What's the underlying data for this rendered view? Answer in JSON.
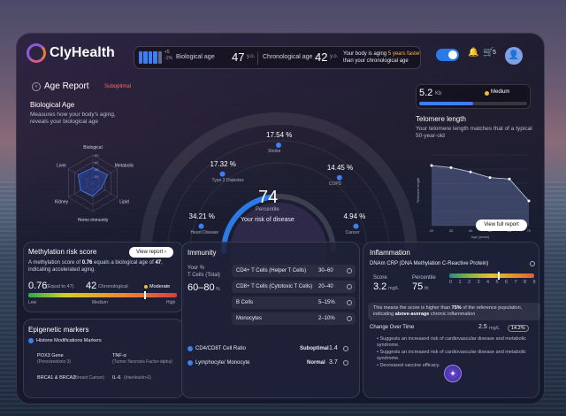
{
  "app": {
    "name": "ClyHealth"
  },
  "status": {
    "battery_delta": "+5",
    "battery_delta2": "-1%",
    "bio_label": "Biological age",
    "bio_val": "47",
    "bio_unit": "y.o.",
    "chrono_label": "Chronological age",
    "chrono_val": "42",
    "chrono_unit": "y.o.",
    "note_a": "Your body is aging ",
    "note_hl": "5 years faster",
    "note_b": " than your chronological age",
    "cart_count": "5"
  },
  "page": {
    "back": "‹",
    "title": "Age Report",
    "tag": "Suboptimal"
  },
  "bio": {
    "title": "Biological Age",
    "desc": "Measures how your body's aging, reveals your biological age",
    "radar": {
      "axes": [
        "Biological",
        "Metabolic",
        "Lipid",
        "Hemo immunity",
        "Kidney",
        "Liver"
      ],
      "values": [
        0.55,
        0.6,
        0.35,
        0.45,
        0.5,
        0.6
      ],
      "ticks": [
        "80",
        "60",
        "40",
        "20"
      ]
    }
  },
  "gauge": {
    "value": "74",
    "unit": "Percentile",
    "label": "Your risk of disease",
    "fill": 0.74,
    "metrics": [
      {
        "label": "Stroke",
        "value": "17.54",
        "unit": "%"
      },
      {
        "label": "COPD",
        "value": "14.45",
        "unit": "%"
      },
      {
        "label": "Type 2 Diabetes",
        "value": "17.32",
        "unit": "%"
      },
      {
        "label": "Cancer",
        "value": "4.94",
        "unit": "%"
      },
      {
        "label": "Heart Disease",
        "value": "34.21",
        "unit": "%"
      }
    ]
  },
  "telomere": {
    "value": "5.2",
    "unit": "Kb",
    "status": "Medium",
    "fill": 0.5,
    "title": "Telomere length",
    "desc": "Your telomere length matches that of a typical 50-year-old",
    "chart": {
      "x": [
        20,
        30,
        40,
        50,
        60,
        70
      ],
      "y": [
        8.5,
        8.2,
        7.6,
        6.8,
        6.6,
        3.5
      ],
      "ylabel": "Telomere length",
      "xlabel": "Age (years)"
    },
    "button": "View full report"
  },
  "methylation": {
    "title": "Methylation risk score",
    "button": "View report",
    "desc_a": "A methylation score of ",
    "desc_b": "0.76",
    "desc_c": " equals a biological age of ",
    "desc_d": "47",
    "desc_e": ", indicating accelerated aging.",
    "score": "0.76",
    "score_sub": "(Equal to 47)",
    "chrono": "42",
    "chrono_lbl": "Chronological",
    "level": "Moderate",
    "low": "Low",
    "medium": "Medium",
    "high": "High",
    "marker": 0.78
  },
  "epigenetic": {
    "title": "Epigenetic markers",
    "section": "Histone Modifications Markers",
    "items": [
      {
        "name": "POX3 Gene",
        "sub": "(Peroxiredoxin 3)"
      },
      {
        "name": "TNF-α",
        "sub": "(Tumor Necrosis Factor-alpha)"
      },
      {
        "name": "BRCA1 & BRCA2",
        "sub": "(Breast Cancer)"
      },
      {
        "name": "IL-6",
        "sub": "(Interleukin-6)"
      }
    ]
  },
  "immunity": {
    "title": "Immunity",
    "your": "Your %",
    "total": "T Cells (Total)",
    "range": "60–80",
    "range_unit": "%",
    "rows": [
      {
        "label": "CD4+ T Cells (Helper T Cells)",
        "value": "30–60",
        "unit": "%"
      },
      {
        "label": "CD8+ T Cells (Cytotoxic T Cells)",
        "value": "20–40",
        "unit": "%"
      },
      {
        "label": "B Cells",
        "value": "5–15%",
        "unit": "%"
      },
      {
        "label": "Monocytes",
        "value": "2–10%",
        "unit": "%"
      }
    ],
    "ratios": [
      {
        "label": "CD4/CD8T Cell Ratio",
        "status": "Suboptimal",
        "value": "1.4"
      },
      {
        "label": "Lymphocyte/ Monocyte",
        "status": "Normal",
        "value": "3.7"
      }
    ]
  },
  "inflammation": {
    "title": "Inflammation",
    "sub": "DNAm CRP (DNA Methylation C-Reactive Protein)",
    "score_lbl": "Score",
    "score": "3.2",
    "score_unit": "mg/L",
    "pct_lbl": "Percentile",
    "pct": "75",
    "pct_unit": "th",
    "scale": [
      "0",
      "1",
      "2",
      "3",
      "4",
      "5",
      "6",
      "7",
      "8",
      "9"
    ],
    "callout_a": "This means the score is higher than ",
    "callout_b": "75%",
    "callout_c": " of the reference population, indicating ",
    "callout_d": "above-average",
    "callout_e": " chronic inflammation",
    "change_lbl": "Change Over Time",
    "change_val": "2.5",
    "change_unit": "mg/L",
    "change_pct": "14.2%",
    "bullets": [
      "Suggests an increased risk of cardiovascular disease and metabolic syndrome.",
      "Suggests an increased risk of cardiovascular disease and metabolic syndrome.",
      "Decreased vaccine efficacy."
    ]
  }
}
